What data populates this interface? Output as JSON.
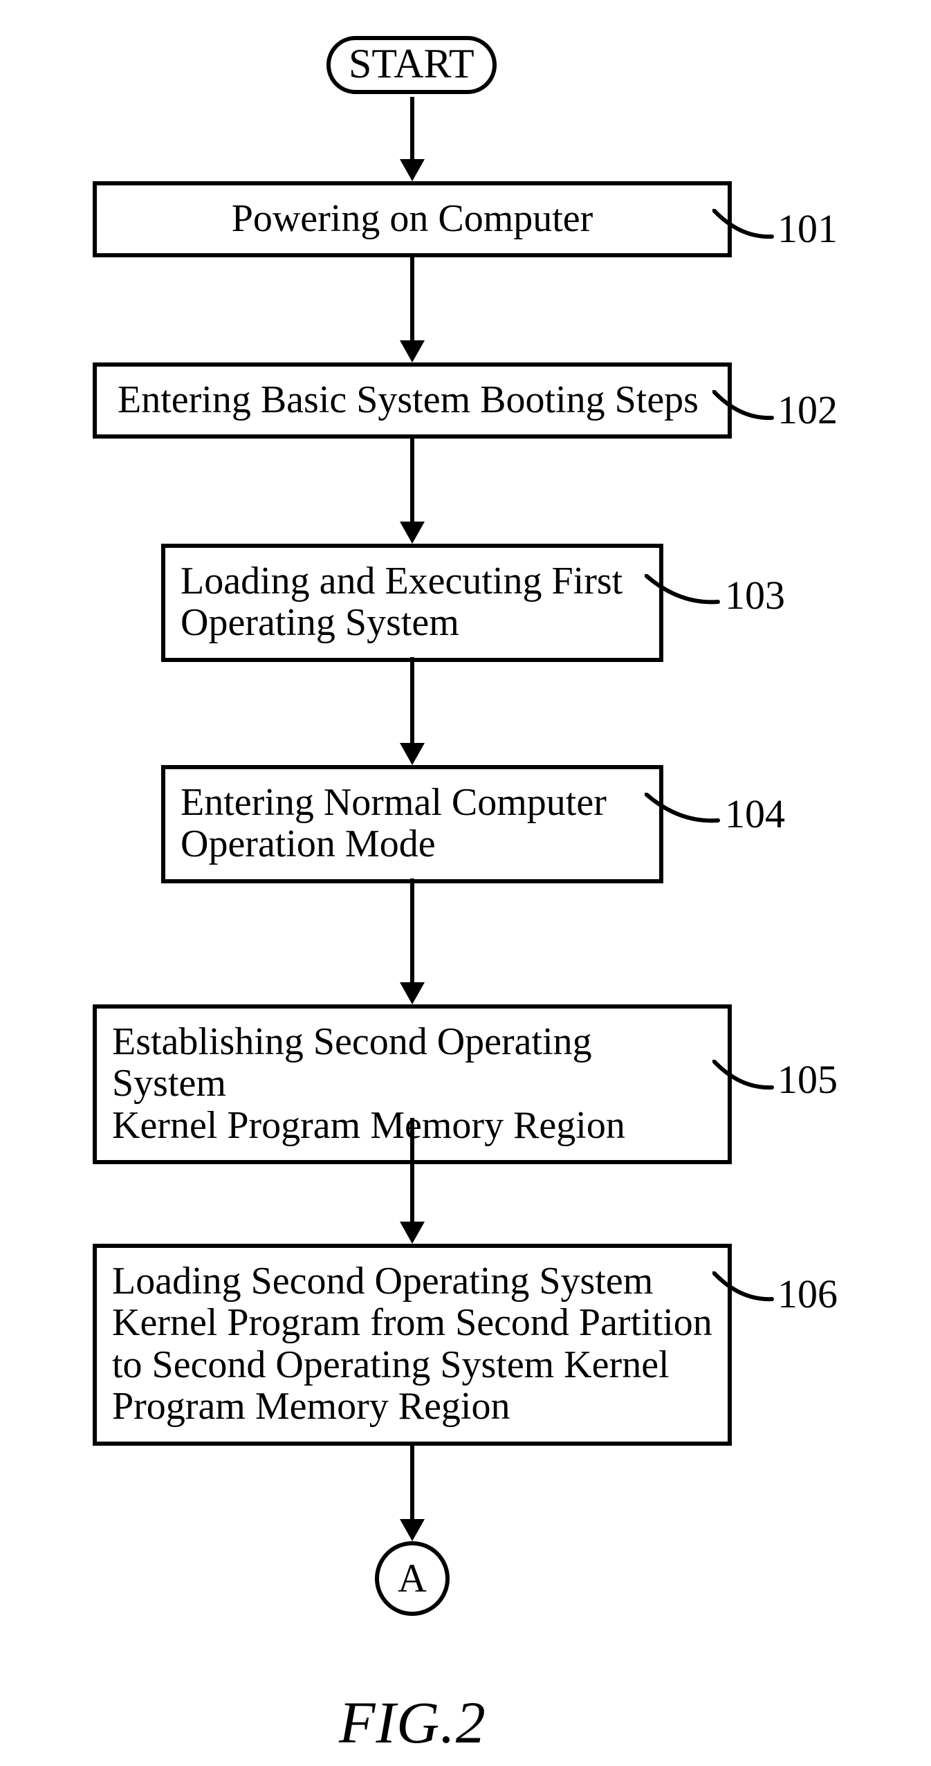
{
  "start": "START",
  "steps": {
    "s101": {
      "text": "Powering on Computer",
      "num": "101"
    },
    "s102": {
      "text": "Entering Basic System Booting Steps",
      "num": "102"
    },
    "s103": {
      "text": "Loading and Executing First\nOperating System",
      "num": "103"
    },
    "s104": {
      "text": "Entering Normal Computer\nOperation Mode",
      "num": "104"
    },
    "s105": {
      "text": "Establishing Second Operating System\nKernel Program Memory Region",
      "num": "105"
    },
    "s106": {
      "text": "Loading Second Operating System\nKernel Program from Second Partition\nto Second Operating System Kernel\nProgram Memory Region",
      "num": "106"
    }
  },
  "connector": "A",
  "figure": "FIG.2"
}
